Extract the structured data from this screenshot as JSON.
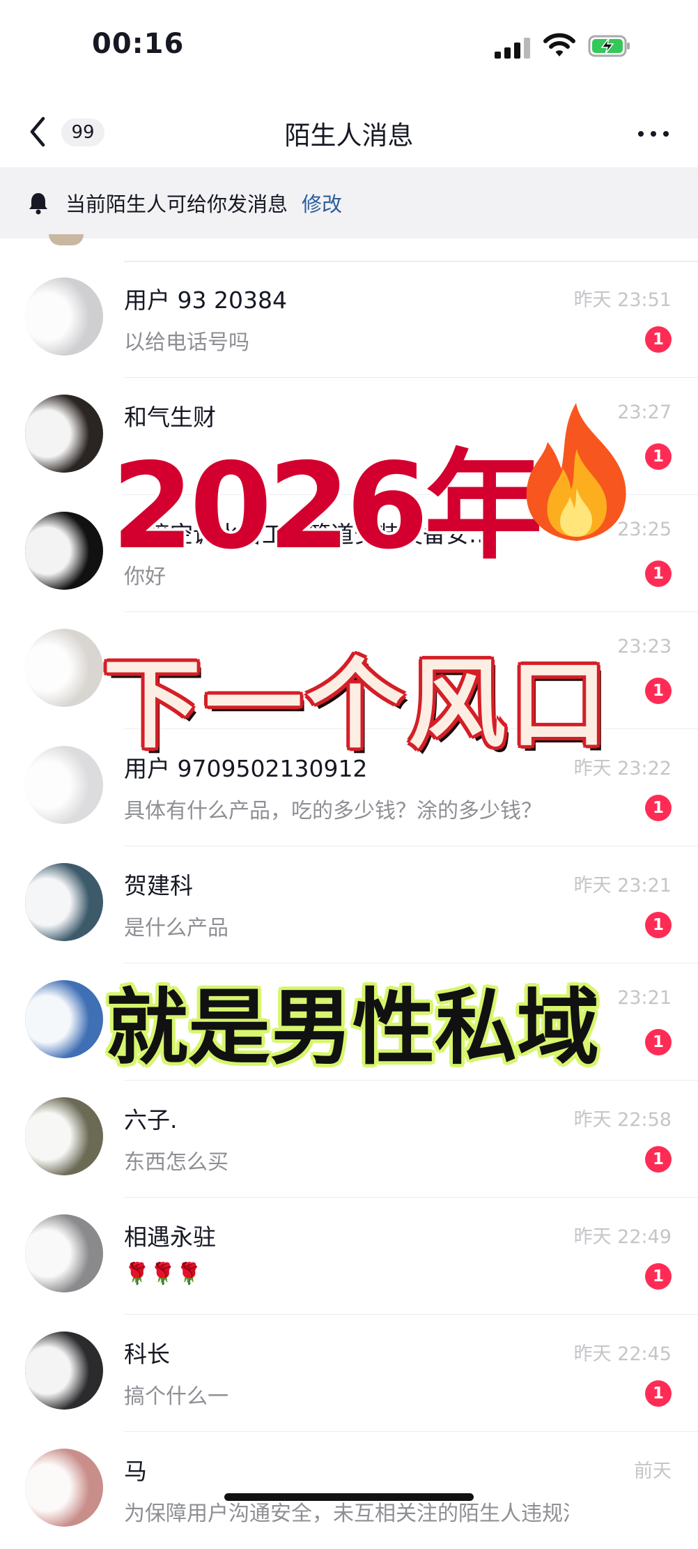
{
  "status_bar": {
    "time": "00:16"
  },
  "nav": {
    "back_count": "99",
    "title": "陌生人消息"
  },
  "notice": {
    "text": "当前陌生人可给你发消息",
    "link": "修改"
  },
  "conversations": [
    {
      "name": "用户 93      20384",
      "time": "昨天 23:51",
      "message": "以给电话号吗",
      "badge": "1"
    },
    {
      "name": "和气生财",
      "time": "23:27",
      "message": "",
      "badge": "1"
    },
    {
      "name": "承接空调水管工艺管道安装设备安…",
      "time": "23:25",
      "message": "你好",
      "badge": "1"
    },
    {
      "name": "",
      "time": "23:23",
      "message": "",
      "badge": "1"
    },
    {
      "name": "用户 9709502130912",
      "time": "昨天 23:22",
      "message": "具体有什么产品，吃的多少钱？涂的多少钱？",
      "badge": "1"
    },
    {
      "name": "贺建科",
      "time": "昨天 23:21",
      "message": "是什么产品",
      "badge": "1"
    },
    {
      "name": "",
      "time": "23:21",
      "message": "",
      "badge": "1"
    },
    {
      "name": "六子.",
      "time": "昨天 22:58",
      "message": "东西怎么买",
      "badge": "1"
    },
    {
      "name": "相遇永驻",
      "time": "昨天 22:49",
      "message": "🌹🌹🌹",
      "badge": "1"
    },
    {
      "name": "科长",
      "time": "昨天 22:45",
      "message": "搞个什么一",
      "badge": "1"
    },
    {
      "name": "马",
      "time": "前天",
      "message": "为保障用户沟通安全，未互相关注的陌生人违规消息",
      "badge": ""
    }
  ],
  "overlay": {
    "year": "2026年",
    "phrase1": "下一个风口",
    "phrase2": "就是男性私域"
  },
  "colors": {
    "badge": "#fe2c55",
    "link": "#2c5d9b",
    "year_text": "#d3002f",
    "phrase1_outline": "#d41f27",
    "phrase2_outline": "#d7f56e"
  },
  "icons": [
    "back-chevron-icon",
    "more-dots-icon",
    "bell-icon",
    "signal-icon",
    "wifi-icon",
    "battery-charging-icon",
    "fire-emoji-icon"
  ]
}
